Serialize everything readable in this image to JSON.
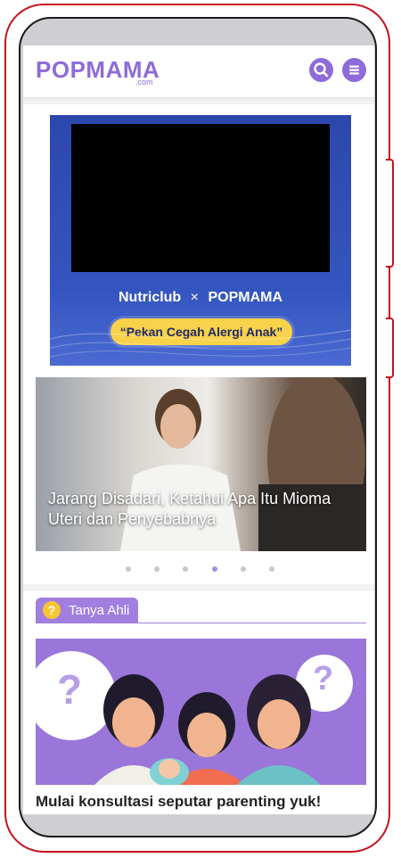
{
  "header": {
    "logo": "POPMAMA",
    "logo_sub": ".com",
    "search_icon": "search-icon",
    "menu_icon": "hamburger-menu-icon"
  },
  "promo": {
    "brand_left": "Nutriclub",
    "brand_sep": "×",
    "brand_right": "POPMAMA",
    "tagline": "“Pekan Cegah Alergi Anak”"
  },
  "carousel": {
    "title": "Jarang Disadari, Ketahui Apa Itu Mioma Uteri dan Penyebabnya",
    "dots_total": 6,
    "active_index": 3
  },
  "tanya_ahli": {
    "label": "Tanya Ahli",
    "icon": "?",
    "cta": "Mulai konsultasi seputar parenting yuk!"
  },
  "colors": {
    "brand_purple": "#8e6bd9",
    "phone_frame": "#c4121d",
    "promo_blue": "#2f4fb5",
    "pill_yellow": "#f8d24a"
  }
}
